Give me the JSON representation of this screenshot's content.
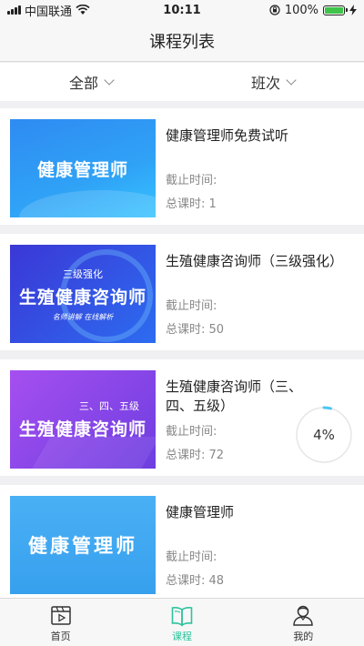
{
  "status_bar": {
    "carrier": "中国联通",
    "time": "10:11",
    "battery": "100%"
  },
  "header": {
    "title": "课程列表"
  },
  "filters": [
    {
      "label": "全部"
    },
    {
      "label": "班次"
    }
  ],
  "courses": [
    {
      "thumb": {
        "main": "健康管理师"
      },
      "title": "健康管理师免费试听",
      "deadline": "截止时间:",
      "total_hours": "总课时: 1",
      "progress": null
    },
    {
      "thumb": {
        "tag": "三级强化",
        "main": "生殖健康咨询师",
        "sub": "名师讲解 在线解析"
      },
      "title": "生殖健康咨询师（三级强化）",
      "deadline": "截止时间:",
      "total_hours": "总课时: 50",
      "progress": null
    },
    {
      "thumb": {
        "tag": "三、四、五级",
        "main": "生殖健康咨询师"
      },
      "title": "生殖健康咨询师（三、四、五级）",
      "deadline": "截止时间:",
      "total_hours": "总课时: 72",
      "progress": "4%",
      "progress_value": 0.04
    },
    {
      "thumb": {
        "main": "健康管理师"
      },
      "title": "健康管理师",
      "deadline": "截止时间:",
      "total_hours": "总课时: 48",
      "progress": null
    }
  ],
  "tab_bar": [
    {
      "label": "首页",
      "icon": "video-icon",
      "active": false
    },
    {
      "label": "课程",
      "icon": "book-icon",
      "active": true
    },
    {
      "label": "我的",
      "icon": "profile-icon",
      "active": false
    }
  ],
  "colors": {
    "accent": "#2cc39d",
    "progress": "#4cc6f0"
  }
}
